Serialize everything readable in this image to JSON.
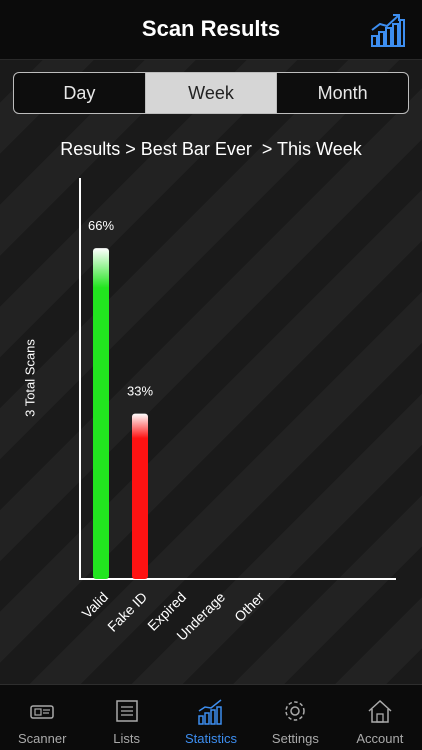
{
  "header": {
    "title": "Scan Results",
    "icon": "bar-chart-icon"
  },
  "segments": [
    {
      "label": "Day",
      "active": false
    },
    {
      "label": "Week",
      "active": true
    },
    {
      "label": "Month",
      "active": false
    }
  ],
  "breadcrumb": "Results > Best Bar Ever  > This Week",
  "colors": {
    "valid_green": "#22e51f",
    "fake_red": "#ff1212",
    "accent_blue": "#3d8ef0"
  },
  "chart_data": {
    "type": "bar",
    "ylabel": "3 Total Scans",
    "categories": [
      "Valid",
      "Fake ID",
      "Expired",
      "Underage",
      "Other"
    ],
    "values": [
      66,
      33,
      0,
      0,
      0
    ],
    "value_labels": [
      "66%",
      "33%",
      "",
      "",
      ""
    ],
    "ylim": [
      0,
      80
    ],
    "grid": false
  },
  "tabbar": [
    {
      "label": "Scanner",
      "icon": "scanner-icon",
      "active": false
    },
    {
      "label": "Lists",
      "icon": "list-icon",
      "active": false
    },
    {
      "label": "Statistics",
      "icon": "statistics-icon",
      "active": true
    },
    {
      "label": "Settings",
      "icon": "gear-icon",
      "active": false
    },
    {
      "label": "Account",
      "icon": "home-icon",
      "active": false
    }
  ]
}
